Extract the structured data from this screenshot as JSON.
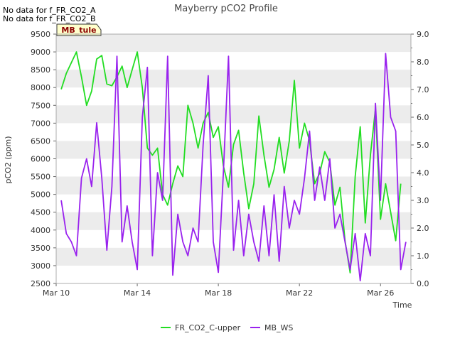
{
  "chart_data": {
    "type": "line",
    "title": "Mayberry pCO2 Profile",
    "xlabel": "Time",
    "ylabel": "pCO2 (ppm)",
    "ylim": [
      2500,
      9500
    ],
    "y2lim": [
      0.0,
      9.0
    ],
    "x_range": [
      "2000-03-10",
      "2000-03-27T12:00"
    ],
    "x_tick_labels": [
      "Mar 10",
      "Mar 14",
      "Mar 18",
      "Mar 22",
      "Mar 26"
    ],
    "x_tick_dates": [
      "2000-03-10",
      "2000-03-14",
      "2000-03-18",
      "2000-03-22",
      "2000-03-26"
    ],
    "y_ticks": [
      2500,
      3000,
      3500,
      4000,
      4500,
      5000,
      5500,
      6000,
      6500,
      7000,
      7500,
      8000,
      8500,
      9000,
      9500
    ],
    "y2_ticks": [
      "0.0",
      "1.0",
      "2.0",
      "3.0",
      "4.0",
      "5.0",
      "6.0",
      "7.0",
      "8.0",
      "9.0"
    ],
    "grid": "horizontal bands",
    "legend_position": "bottom-center",
    "no_data_notes": [
      "No data for f_FR_CO2_A",
      "No data for f_FR_CO2_B"
    ],
    "tag": "MB_tule",
    "series": [
      {
        "name": "FR_CO2_C-upper",
        "axis": "left",
        "color": "#22dd22",
        "points": [
          [
            "2000-03-10T06:00",
            7950
          ],
          [
            "2000-03-10T12:00",
            8400
          ],
          [
            "2000-03-10T18:00",
            8700
          ],
          [
            "2000-03-11T00:00",
            9000
          ],
          [
            "2000-03-11T06:00",
            8300
          ],
          [
            "2000-03-11T12:00",
            7500
          ],
          [
            "2000-03-11T18:00",
            7900
          ],
          [
            "2000-03-12T00:00",
            8800
          ],
          [
            "2000-03-12T06:00",
            8900
          ],
          [
            "2000-03-12T12:00",
            8100
          ],
          [
            "2000-03-12T18:00",
            8050
          ],
          [
            "2000-03-13T00:00",
            8300
          ],
          [
            "2000-03-13T06:00",
            8600
          ],
          [
            "2000-03-13T12:00",
            8000
          ],
          [
            "2000-03-13T18:00",
            8500
          ],
          [
            "2000-03-14T00:00",
            9000
          ],
          [
            "2000-03-14T06:00",
            8000
          ],
          [
            "2000-03-14T12:00",
            6300
          ],
          [
            "2000-03-14T18:00",
            6100
          ],
          [
            "2000-03-15T00:00",
            6300
          ],
          [
            "2000-03-15T06:00",
            5000
          ],
          [
            "2000-03-15T12:00",
            4700
          ],
          [
            "2000-03-15T18:00",
            5300
          ],
          [
            "2000-03-16T00:00",
            5800
          ],
          [
            "2000-03-16T06:00",
            5500
          ],
          [
            "2000-03-16T12:00",
            7500
          ],
          [
            "2000-03-16T18:00",
            7000
          ],
          [
            "2000-03-17T00:00",
            6300
          ],
          [
            "2000-03-17T06:00",
            7000
          ],
          [
            "2000-03-17T12:00",
            7300
          ],
          [
            "2000-03-17T18:00",
            6600
          ],
          [
            "2000-03-18T00:00",
            6900
          ],
          [
            "2000-03-18T06:00",
            5800
          ],
          [
            "2000-03-18T12:00",
            5200
          ],
          [
            "2000-03-18T18:00",
            6400
          ],
          [
            "2000-03-19T00:00",
            6800
          ],
          [
            "2000-03-19T06:00",
            5600
          ],
          [
            "2000-03-19T12:00",
            4600
          ],
          [
            "2000-03-19T18:00",
            5300
          ],
          [
            "2000-03-20T00:00",
            7200
          ],
          [
            "2000-03-20T06:00",
            6100
          ],
          [
            "2000-03-20T12:00",
            5200
          ],
          [
            "2000-03-20T18:00",
            5700
          ],
          [
            "2000-03-21T00:00",
            6600
          ],
          [
            "2000-03-21T06:00",
            5600
          ],
          [
            "2000-03-21T12:00",
            6500
          ],
          [
            "2000-03-21T18:00",
            8200
          ],
          [
            "2000-03-22T00:00",
            6300
          ],
          [
            "2000-03-22T06:00",
            7000
          ],
          [
            "2000-03-22T12:00",
            6500
          ],
          [
            "2000-03-22T18:00",
            5300
          ],
          [
            "2000-03-23T00:00",
            5600
          ],
          [
            "2000-03-23T06:00",
            6200
          ],
          [
            "2000-03-23T12:00",
            5900
          ],
          [
            "2000-03-23T18:00",
            4700
          ],
          [
            "2000-03-24T00:00",
            5200
          ],
          [
            "2000-03-24T06:00",
            3700
          ],
          [
            "2000-03-24T12:00",
            2800
          ],
          [
            "2000-03-24T18:00",
            5500
          ],
          [
            "2000-03-25T00:00",
            6900
          ],
          [
            "2000-03-25T06:00",
            4200
          ],
          [
            "2000-03-25T12:00",
            6100
          ],
          [
            "2000-03-25T18:00",
            7400
          ],
          [
            "2000-03-26T00:00",
            4300
          ],
          [
            "2000-03-26T06:00",
            5300
          ],
          [
            "2000-03-26T12:00",
            4500
          ],
          [
            "2000-03-26T18:00",
            3700
          ],
          [
            "2000-03-27T00:00",
            5300
          ]
        ]
      },
      {
        "name": "MB_WS",
        "axis": "right",
        "color": "#9922ee",
        "points": [
          [
            "2000-03-10T06:00",
            3.0
          ],
          [
            "2000-03-10T12:00",
            1.8
          ],
          [
            "2000-03-10T18:00",
            1.5
          ],
          [
            "2000-03-11T00:00",
            1.0
          ],
          [
            "2000-03-11T06:00",
            3.8
          ],
          [
            "2000-03-11T12:00",
            4.5
          ],
          [
            "2000-03-11T18:00",
            3.5
          ],
          [
            "2000-03-12T00:00",
            5.8
          ],
          [
            "2000-03-12T06:00",
            3.8
          ],
          [
            "2000-03-12T12:00",
            1.2
          ],
          [
            "2000-03-12T18:00",
            3.5
          ],
          [
            "2000-03-13T00:00",
            8.2
          ],
          [
            "2000-03-13T06:00",
            1.5
          ],
          [
            "2000-03-13T12:00",
            2.8
          ],
          [
            "2000-03-13T18:00",
            1.5
          ],
          [
            "2000-03-14T00:00",
            0.5
          ],
          [
            "2000-03-14T06:00",
            6.0
          ],
          [
            "2000-03-14T12:00",
            7.8
          ],
          [
            "2000-03-14T18:00",
            1.0
          ],
          [
            "2000-03-15T00:00",
            4.0
          ],
          [
            "2000-03-15T06:00",
            3.0
          ],
          [
            "2000-03-15T12:00",
            8.2
          ],
          [
            "2000-03-15T18:00",
            0.3
          ],
          [
            "2000-03-16T00:00",
            2.5
          ],
          [
            "2000-03-16T06:00",
            1.5
          ],
          [
            "2000-03-16T12:00",
            1.0
          ],
          [
            "2000-03-16T18:00",
            2.0
          ],
          [
            "2000-03-17T00:00",
            1.5
          ],
          [
            "2000-03-17T06:00",
            5.0
          ],
          [
            "2000-03-17T12:00",
            7.5
          ],
          [
            "2000-03-17T18:00",
            1.5
          ],
          [
            "2000-03-18T00:00",
            0.4
          ],
          [
            "2000-03-18T06:00",
            4.0
          ],
          [
            "2000-03-18T12:00",
            8.2
          ],
          [
            "2000-03-18T18:00",
            1.2
          ],
          [
            "2000-03-19T00:00",
            3.0
          ],
          [
            "2000-03-19T06:00",
            1.0
          ],
          [
            "2000-03-19T12:00",
            2.5
          ],
          [
            "2000-03-19T18:00",
            1.5
          ],
          [
            "2000-03-20T00:00",
            0.8
          ],
          [
            "2000-03-20T06:00",
            2.8
          ],
          [
            "2000-03-20T12:00",
            1.0
          ],
          [
            "2000-03-20T18:00",
            3.2
          ],
          [
            "2000-03-21T00:00",
            0.8
          ],
          [
            "2000-03-21T06:00",
            3.5
          ],
          [
            "2000-03-21T12:00",
            2.0
          ],
          [
            "2000-03-21T18:00",
            3.0
          ],
          [
            "2000-03-22T00:00",
            2.5
          ],
          [
            "2000-03-22T06:00",
            3.8
          ],
          [
            "2000-03-22T12:00",
            5.5
          ],
          [
            "2000-03-22T18:00",
            3.0
          ],
          [
            "2000-03-23T00:00",
            4.2
          ],
          [
            "2000-03-23T06:00",
            3.0
          ],
          [
            "2000-03-23T12:00",
            4.5
          ],
          [
            "2000-03-23T18:00",
            2.0
          ],
          [
            "2000-03-24T00:00",
            2.5
          ],
          [
            "2000-03-24T06:00",
            1.5
          ],
          [
            "2000-03-24T12:00",
            0.5
          ],
          [
            "2000-03-24T18:00",
            1.8
          ],
          [
            "2000-03-25T00:00",
            0.1
          ],
          [
            "2000-03-25T06:00",
            1.8
          ],
          [
            "2000-03-25T12:00",
            1.0
          ],
          [
            "2000-03-25T18:00",
            6.5
          ],
          [
            "2000-03-26T00:00",
            3.0
          ],
          [
            "2000-03-26T06:00",
            8.3
          ],
          [
            "2000-03-26T12:00",
            6.0
          ],
          [
            "2000-03-26T18:00",
            5.5
          ],
          [
            "2000-03-27T00:00",
            0.5
          ],
          [
            "2000-03-27T06:00",
            1.5
          ]
        ]
      }
    ]
  }
}
